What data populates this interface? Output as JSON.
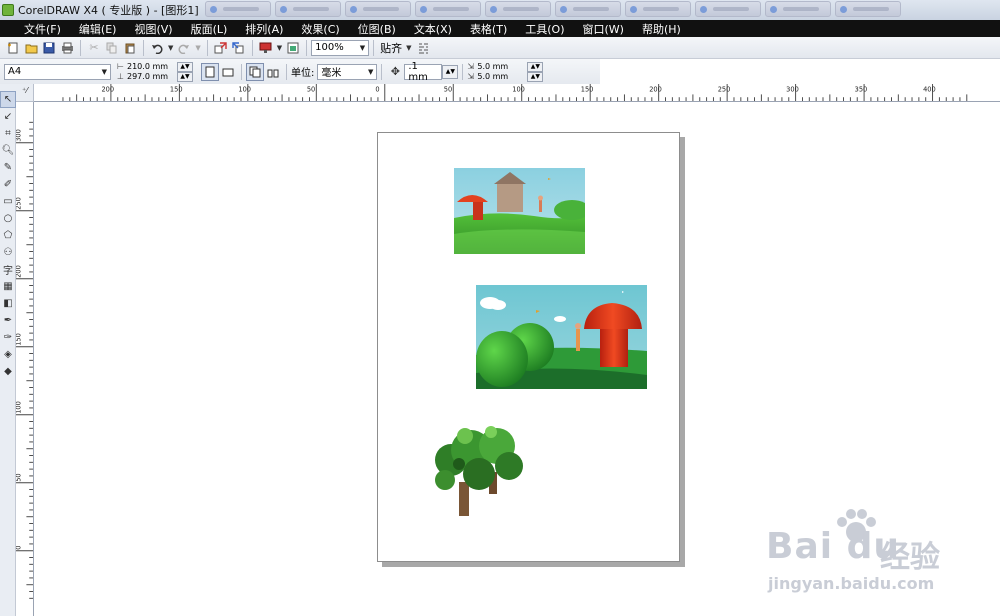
{
  "window": {
    "title": "CorelDRAW X4 ( 专业版 ) - [图形1]"
  },
  "menubar": [
    "文件(F)",
    "编辑(E)",
    "视图(V)",
    "版面(L)",
    "排列(A)",
    "效果(C)",
    "位图(B)",
    "文本(X)",
    "表格(T)",
    "工具(O)",
    "窗口(W)",
    "帮助(H)"
  ],
  "toolbar": {
    "zoom_value": "100%",
    "snap_label": "贴齐"
  },
  "property_bar": {
    "page_size": "A4",
    "width_value": "210.0 mm",
    "height_value": "297.0 mm",
    "units_label": "单位:",
    "units_value": "毫米",
    "nudge_value": ".1 mm",
    "dup_x_value": "5.0 mm",
    "dup_y_value": "5.0 mm"
  },
  "rulers": {
    "h_ticks": [
      "200",
      "150",
      "100",
      "50",
      "0",
      "50",
      "100",
      "150",
      "200",
      "250",
      "300",
      "350",
      "400"
    ],
    "v_ticks": [
      "300",
      "250",
      "200",
      "150",
      "100",
      "50",
      "0"
    ]
  },
  "canvas": {
    "objects": [
      {
        "name": "scene-house-image"
      },
      {
        "name": "scene-mushroom-image"
      },
      {
        "name": "tree-image"
      }
    ]
  },
  "watermark": {
    "brand": "Bai du",
    "cn": "经验",
    "url": "jingyan.baidu.com"
  },
  "colors": {
    "menubar_bg": "#111111",
    "page_shadow": "#a8a8a8",
    "sky": "#7fc8d6",
    "grass": "#3faa3a",
    "mushroom": "#e2361b"
  }
}
